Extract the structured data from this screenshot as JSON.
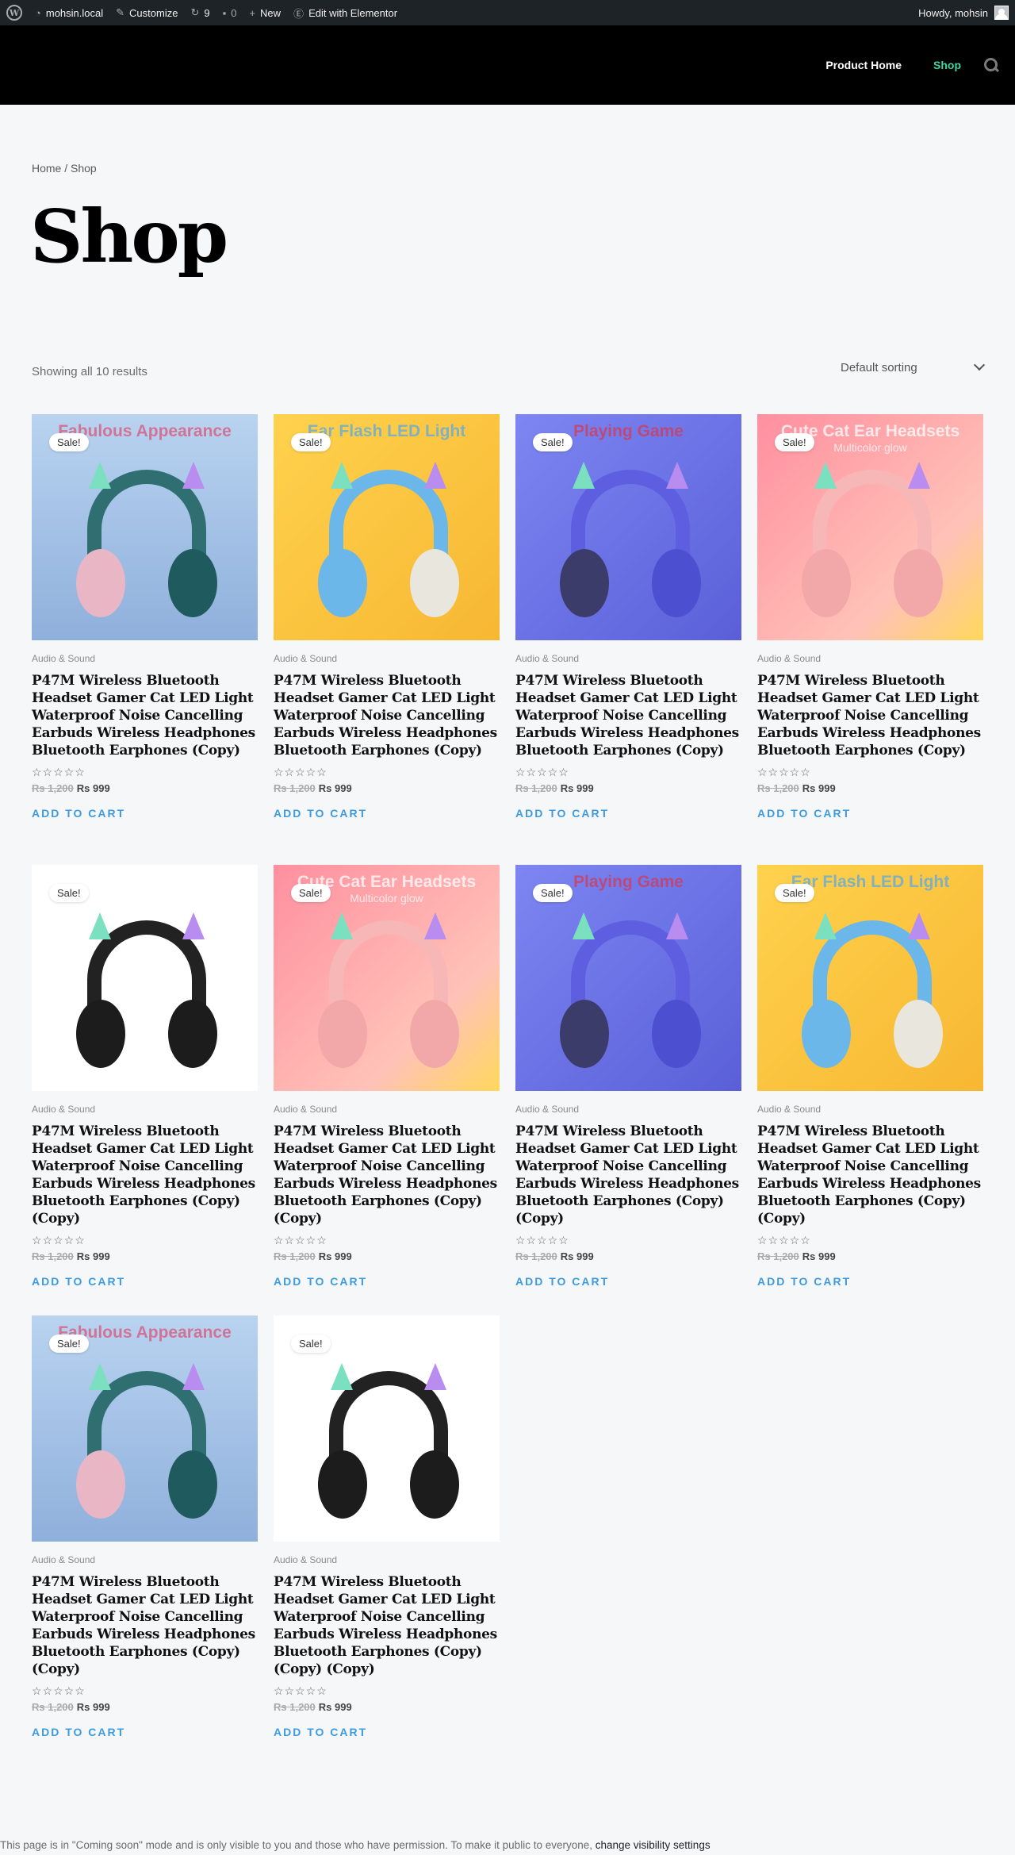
{
  "adminbar": {
    "site": "mohsin.local",
    "customize": "Customize",
    "updates": "9",
    "comments": "0",
    "new": "New",
    "elementor": "Edit with Elementor",
    "howdy": "Howdy, mohsin"
  },
  "nav": {
    "items": [
      "Product Home",
      "Shop"
    ],
    "active": "Shop"
  },
  "breadcrumb": "Home / Shop",
  "page_title": "Shop",
  "result_count": "Showing all 10 results",
  "sorting": {
    "selected": "Default sorting"
  },
  "sale_label": "Sale!",
  "category": "Audio & Sound",
  "base_title": "P47M Wireless Bluetooth Headset Gamer Cat LED Light Waterproof Noise Cancelling Earbuds Wireless Headphones Bluetooth Earphones",
  "price": {
    "old": "Rs 1,200",
    "new": "Rs 999"
  },
  "stars": "☆☆☆☆☆",
  "add_to_cart": "ADD TO CART",
  "products": [
    {
      "title": "P47M Wireless Bluetooth Headset Gamer Cat LED Light Waterproof Noise Cancelling Earbuds Wireless Headphones Bluetooth Earphones (Copy)",
      "image": "fabulous",
      "banner": "Fabulous Appearance",
      "sub": ""
    },
    {
      "title": "P47M Wireless Bluetooth Headset Gamer Cat LED Light Waterproof Noise Cancelling Earbuds Wireless Headphones Bluetooth Earphones (Copy)",
      "image": "flash",
      "banner": "Ear Flash LED Light",
      "sub": ""
    },
    {
      "title": "P47M Wireless Bluetooth Headset Gamer Cat LED Light Waterproof Noise Cancelling Earbuds Wireless Headphones Bluetooth Earphones (Copy)",
      "image": "playing",
      "banner": "Playing Game",
      "sub": ""
    },
    {
      "title": "P47M Wireless Bluetooth Headset Gamer Cat LED Light Waterproof Noise Cancelling Earbuds Wireless Headphones Bluetooth Earphones (Copy)",
      "image": "cute",
      "banner": "Cute Cat Ear Headsets",
      "sub": "Multicolor glow"
    },
    {
      "title": "P47M Wireless Bluetooth Headset Gamer Cat LED Light Waterproof Noise Cancelling Earbuds Wireless Headphones Bluetooth Earphones (Copy) (Copy)",
      "image": "black",
      "banner": "",
      "sub": ""
    },
    {
      "title": "P47M Wireless Bluetooth Headset Gamer Cat LED Light Waterproof Noise Cancelling Earbuds Wireless Headphones Bluetooth Earphones (Copy) (Copy)",
      "image": "cute",
      "banner": "Cute Cat Ear Headsets",
      "sub": "Multicolor glow"
    },
    {
      "title": "P47M Wireless Bluetooth Headset Gamer Cat LED Light Waterproof Noise Cancelling Earbuds Wireless Headphones Bluetooth Earphones (Copy) (Copy)",
      "image": "playing",
      "banner": "Playing Game",
      "sub": ""
    },
    {
      "title": "P47M Wireless Bluetooth Headset Gamer Cat LED Light Waterproof Noise Cancelling Earbuds Wireless Headphones Bluetooth Earphones (Copy) (Copy)",
      "image": "flash",
      "banner": "Ear Flash LED Light",
      "sub": ""
    },
    {
      "title": "P47M Wireless Bluetooth Headset Gamer Cat LED Light Waterproof Noise Cancelling Earbuds Wireless Headphones Bluetooth Earphones (Copy) (Copy)",
      "image": "fabulous",
      "banner": "Fabulous Appearance",
      "sub": ""
    },
    {
      "title": "P47M Wireless Bluetooth Headset Gamer Cat LED Light Waterproof Noise Cancelling Earbuds Wireless Headphones Bluetooth Earphones (Copy) (Copy) (Copy)",
      "image": "black",
      "banner": "",
      "sub": ""
    }
  ],
  "footer": {
    "text": "This page is in \"Coming soon\" mode and is only visible to you and those who have permission. To make it public to everyone, ",
    "link": "change visibility settings"
  },
  "colors": {
    "accent": "#3ed6a1",
    "link": "#3d9be0",
    "adminbar": "#1d2327",
    "header": "#000000"
  }
}
